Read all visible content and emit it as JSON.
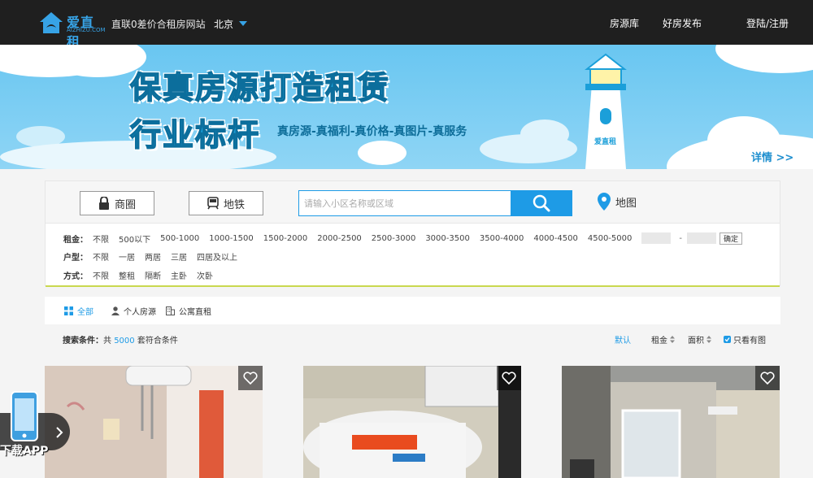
{
  "header": {
    "logo_text": "爱直租",
    "logo_sub": "AIZHIZU.COM",
    "slogan": "直联0差价合租房网站",
    "city": "北京",
    "nav": [
      "房源库",
      "好房发布",
      "登陆/注册"
    ]
  },
  "banner": {
    "title_line1": "保真房源打造租赁",
    "title_line2": "行业标杆",
    "subtitle": "真房源-真福利-真价格-真图片-真服务",
    "lighthouse_label": "爱直租",
    "more": "详情 >>"
  },
  "search": {
    "tab_area": "商圈",
    "tab_subway": "地铁",
    "placeholder": "请输入小区名称或区域",
    "map": "地图"
  },
  "filters": {
    "rent_label": "租金：",
    "rent_options": [
      "不限",
      "500以下",
      "500-1000",
      "1000-1500",
      "1500-2000",
      "2000-2500",
      "2500-3000",
      "3000-3500",
      "3500-4000",
      "4000-4500",
      "4500-5000"
    ],
    "price_dash": "-",
    "confirm": "确定",
    "layout_label": "户型：",
    "layout_options": [
      "不限",
      "一居",
      "两居",
      "三居",
      "四居及以上"
    ],
    "mode_label": "方式：",
    "mode_options": [
      "不限",
      "整租",
      "隔断",
      "主卧",
      "次卧"
    ]
  },
  "categories": {
    "all": "全部",
    "personal": "个人房源",
    "apartment": "公寓直租"
  },
  "results": {
    "prefix": "搜索条件：",
    "mid": "共",
    "count": "5000",
    "suffix": "套符合条件",
    "sort_default": "默认",
    "sort_rent": "租金",
    "sort_area": "面积",
    "only_photo": "只看有图"
  },
  "app": {
    "label": "下载APP"
  },
  "colors": {
    "accent": "#1e9be6",
    "header_bg": "#1f1f1f",
    "banner_bg": "#69c6f1"
  }
}
